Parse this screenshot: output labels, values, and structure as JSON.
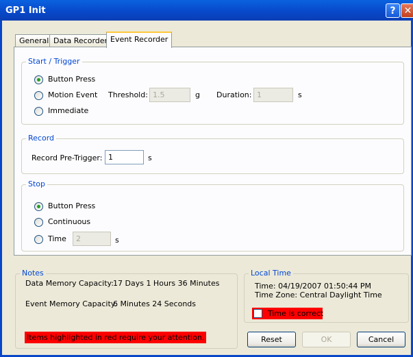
{
  "window": {
    "title": "GP1 Init",
    "help_label": "?",
    "close_label": "✕"
  },
  "tabs": [
    {
      "label": "General"
    },
    {
      "label": "Data Recorder"
    },
    {
      "label": "Event Recorder"
    }
  ],
  "start_trigger": {
    "legend": "Start / Trigger",
    "options": [
      {
        "label": "Button Press",
        "checked": true
      },
      {
        "label": "Motion Event",
        "checked": false
      },
      {
        "label": "Immediate",
        "checked": false
      }
    ],
    "threshold_label": "Threshold:",
    "threshold_value": "1.5",
    "threshold_unit": "g",
    "duration_label": "Duration:",
    "duration_value": "1",
    "duration_unit": "s"
  },
  "record": {
    "legend": "Record",
    "pretrigger_label": "Record Pre-Trigger:",
    "pretrigger_value": "1",
    "pretrigger_unit": "s"
  },
  "stop": {
    "legend": "Stop",
    "options": [
      {
        "label": "Button Press",
        "checked": true
      },
      {
        "label": "Continuous",
        "checked": false
      },
      {
        "label": "Time",
        "checked": false
      }
    ],
    "time_value": "2",
    "time_unit": "s"
  },
  "notes": {
    "legend": "Notes",
    "data_memory_label": "Data Memory Capacity:",
    "data_memory_value": "17 Days 1 Hours 36 Minutes",
    "event_memory_label": "Event Memory Capacity:",
    "event_memory_value": "6 Minutes 24 Seconds",
    "warning": "Items highlighted in red require your attention."
  },
  "local_time": {
    "legend": "Local Time",
    "time_line": "Time: 04/19/2007 01:50:44 PM",
    "zone_line": "Time Zone: Central Daylight Time",
    "checkbox_label": "Time is correct",
    "checked": false
  },
  "buttons": {
    "reset": "Reset",
    "ok": "OK",
    "cancel": "Cancel"
  },
  "colors": {
    "title_bar": "#0847c8",
    "legend_text": "#0046d5",
    "attention": "#ff0000",
    "selected_radio": "#21a121"
  }
}
